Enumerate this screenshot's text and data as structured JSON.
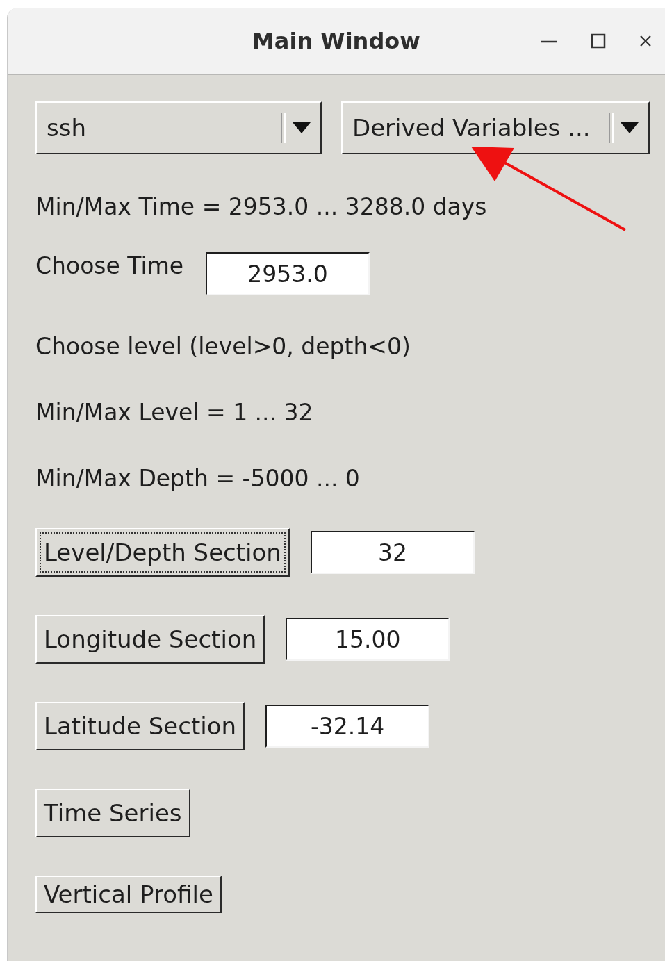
{
  "window": {
    "title": "Main Window"
  },
  "dropdowns": [
    {
      "value": "ssh"
    },
    {
      "value": "Derived Variables ..."
    }
  ],
  "time_range": "Min/Max Time = 2953.0 ... 3288.0 days",
  "choose_time": {
    "label": "Choose Time",
    "value": "2953.0"
  },
  "level_hint": "Choose level (level>0, depth<0)",
  "level_range": "Min/Max Level = 1 ... 32",
  "depth_range": "Min/Max Depth = -5000 ... 0",
  "sections": [
    {
      "button": "Level/Depth Section",
      "focused": true,
      "value": "32"
    },
    {
      "button": "Longitude Section",
      "focused": false,
      "value": "15.00"
    },
    {
      "button": "Latitude Section",
      "focused": false,
      "value": "-32.14"
    },
    {
      "button": "Time Series",
      "focused": false
    },
    {
      "button": "Vertical Profile",
      "focused": false
    }
  ]
}
